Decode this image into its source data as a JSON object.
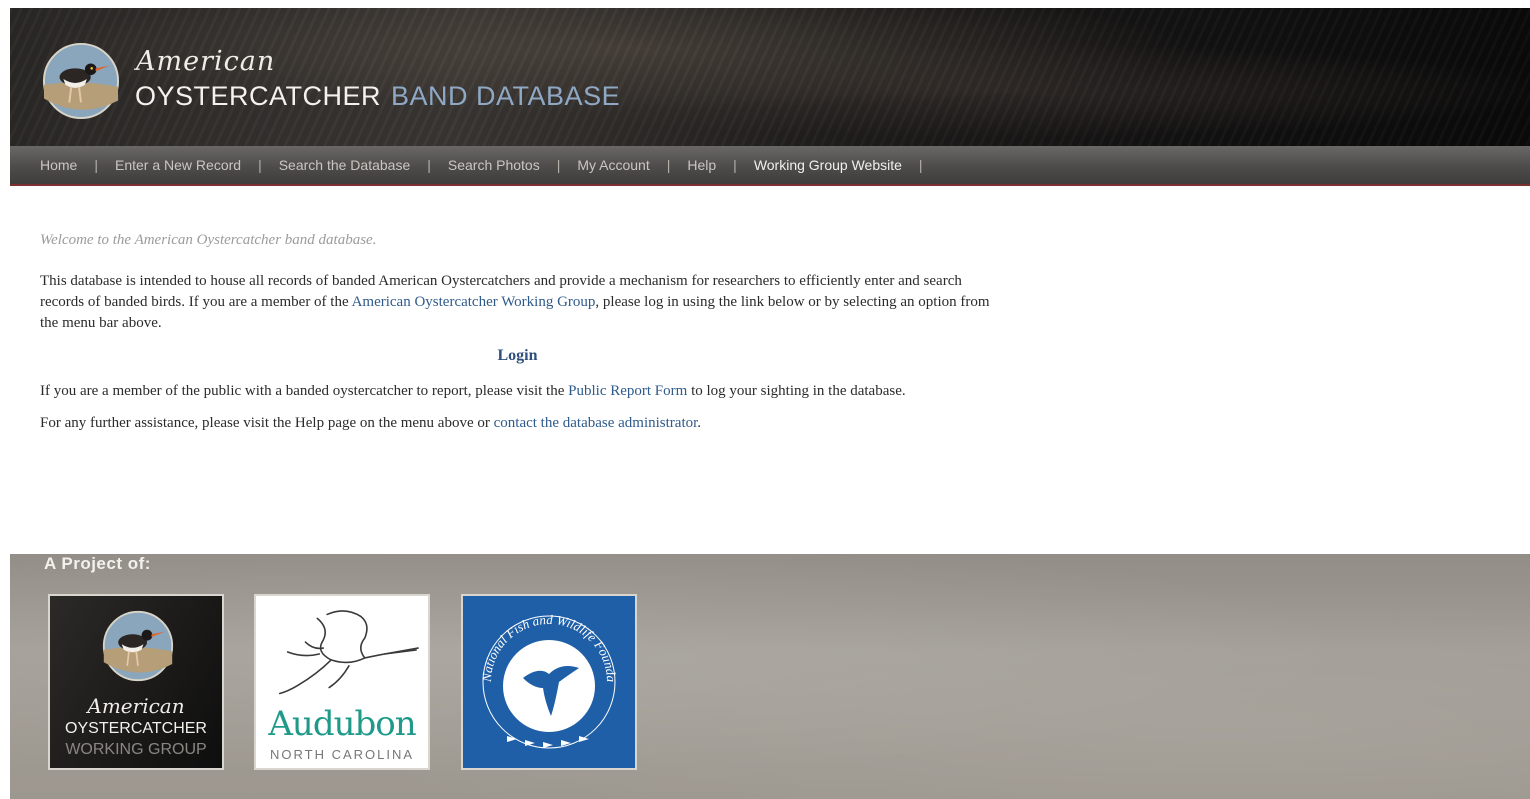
{
  "header": {
    "script_title": "American",
    "title_main": "OYSTERCATCHER",
    "title_sub": "BAND DATABASE"
  },
  "nav": {
    "items": [
      {
        "label": "Home"
      },
      {
        "label": "Enter a New Record"
      },
      {
        "label": "Search the Database"
      },
      {
        "label": "Search Photos"
      },
      {
        "label": "My Account"
      },
      {
        "label": "Help"
      },
      {
        "label": "Working Group Website"
      }
    ],
    "separator": "|"
  },
  "content": {
    "welcome": "Welcome to the American Oystercatcher band database.",
    "intro_before_link": "This database is intended to house all records of banded American Oystercatchers and provide a mechanism for researchers to efficiently enter and search records of banded birds. If you are a member of the ",
    "intro_link": "American Oystercatcher Working Group",
    "intro_after_link": ", please log in using the link below or by selecting an option from the menu bar above.",
    "login_label": "Login",
    "public_before_link": "If you are a member of the public with a banded oystercatcher to report, please visit the ",
    "public_link": "Public Report Form",
    "public_after_link": " to log your sighting in the database.",
    "help_before_link": "For any further assistance, please visit the Help page on the menu above or ",
    "help_link": "contact the database administrator",
    "help_after_link": "."
  },
  "footer": {
    "title": "A Project of:",
    "partners": {
      "aowg": {
        "script": "American",
        "line1": "OYSTERCATCHER",
        "line2": "WORKING GROUP"
      },
      "audubon": {
        "name": "Audubon",
        "state": "NORTH CAROLINA"
      },
      "nfwf": {
        "ring_text": "National Fish and Wildlife Foundation"
      }
    }
  },
  "colors": {
    "link": "#2f5a8c",
    "nav_bg": "#4e4c4a",
    "nav_accent": "#7a3030",
    "header_sub": "#8fa9c4",
    "footer_bg": "#9d988f",
    "nfwf_blue": "#1f5fa8",
    "audubon_teal": "#1f9a8a"
  }
}
